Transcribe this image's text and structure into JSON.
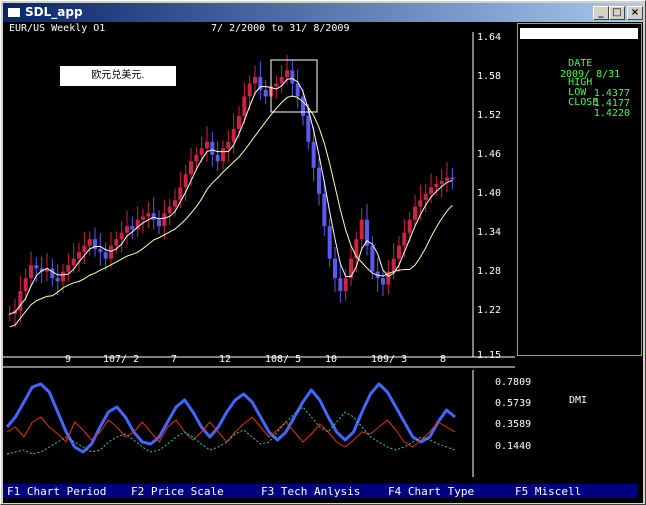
{
  "window": {
    "title": "SDL_app"
  },
  "chart_header": {
    "title": "EUR/US Weekly O1",
    "range": "7/ 2/2000 to 31/ 8/2009"
  },
  "chart_label": "欧元兑美元.",
  "info_panel": {
    "date_label": "DATE",
    "date_value": "2009/ 8/31",
    "high_label": "HIGH",
    "high_value": "1.4377",
    "low_label": "LOW",
    "low_value": "1.4177",
    "close_label": "CLOSE",
    "close_value": "1.4220"
  },
  "oscillator_label": "DMI",
  "function_keys": [
    "F1 Chart Period",
    "F2 Price Scale",
    "F3 Tech Anlysis",
    "F4 Chart Type",
    "F5 Miscell"
  ],
  "colors": {
    "bull": "#cc2244",
    "bear": "#5a5af0",
    "ma_fast": "#ffffff",
    "ma_slow": "#ffffaa",
    "adx": "#4466ff",
    "minus_di": "#dd3311",
    "plus_di": "#33ccaa",
    "panel_text": "#44ff44",
    "fkey_bar": "#000080"
  },
  "chart_data": [
    {
      "type": "candlestick",
      "title": "EUR/US Weekly O1",
      "subtitle": "7/ 2/2000 to 31/ 8/2009",
      "y_ticks": [
        "1.64",
        "1.58",
        "1.52",
        "1.46",
        "1.40",
        "1.34",
        "1.28",
        "1.22",
        "1.15"
      ],
      "ylim": [
        1.15,
        1.64
      ],
      "x_ticks": [
        "9",
        "107/ 2",
        "7",
        "12",
        "108/ 5",
        "10",
        "109/ 3",
        "8"
      ],
      "series": [
        {
          "name": "price",
          "values": [
            1.215,
            1.22,
            1.25,
            1.27,
            1.29,
            1.285,
            1.28,
            1.285,
            1.27,
            1.265,
            1.28,
            1.29,
            1.3,
            1.31,
            1.32,
            1.33,
            1.315,
            1.31,
            1.3,
            1.32,
            1.33,
            1.34,
            1.35,
            1.345,
            1.36,
            1.365,
            1.37,
            1.36,
            1.35,
            1.37,
            1.38,
            1.39,
            1.41,
            1.43,
            1.45,
            1.46,
            1.47,
            1.48,
            1.46,
            1.45,
            1.47,
            1.48,
            1.5,
            1.52,
            1.55,
            1.57,
            1.58,
            1.56,
            1.55,
            1.565,
            1.57,
            1.58,
            1.59,
            1.57,
            1.55,
            1.52,
            1.48,
            1.44,
            1.4,
            1.35,
            1.3,
            1.27,
            1.25,
            1.27,
            1.3,
            1.33,
            1.36,
            1.32,
            1.28,
            1.27,
            1.26,
            1.28,
            1.3,
            1.32,
            1.34,
            1.36,
            1.38,
            1.39,
            1.4,
            1.41,
            1.415,
            1.42,
            1.425,
            1.422
          ]
        }
      ]
    },
    {
      "type": "line",
      "y_ticks": [
        "0.7809",
        "0.5739",
        "0.3589",
        "0.1440"
      ],
      "ylim": [
        0.0,
        0.9
      ],
      "series": [
        {
          "name": "",
          "values": [
            0.35,
            0.45,
            0.6,
            0.75,
            0.78,
            0.7,
            0.5,
            0.3,
            0.15,
            0.1,
            0.18,
            0.35,
            0.5,
            0.55,
            0.45,
            0.3,
            0.2,
            0.18,
            0.25,
            0.4,
            0.55,
            0.62,
            0.5,
            0.35,
            0.25,
            0.35,
            0.5,
            0.62,
            0.68,
            0.6,
            0.45,
            0.3,
            0.22,
            0.3,
            0.45,
            0.6,
            0.72,
            0.62,
            0.45,
            0.3,
            0.22,
            0.3,
            0.5,
            0.68,
            0.78,
            0.7,
            0.55,
            0.4,
            0.25,
            0.2,
            0.25,
            0.4,
            0.52,
            0.45
          ]
        },
        {
          "name": "",
          "values": [
            0.3,
            0.35,
            0.25,
            0.4,
            0.45,
            0.35,
            0.28,
            0.2,
            0.4,
            0.32,
            0.22,
            0.3,
            0.42,
            0.35,
            0.25,
            0.3,
            0.4,
            0.3,
            0.2,
            0.35,
            0.42,
            0.3,
            0.22,
            0.3,
            0.4,
            0.3,
            0.2,
            0.3,
            0.38,
            0.45,
            0.35,
            0.25,
            0.32,
            0.4,
            0.3,
            0.2,
            0.28,
            0.38,
            0.3,
            0.2,
            0.15,
            0.22,
            0.3,
            0.28,
            0.35,
            0.42,
            0.32,
            0.2,
            0.15,
            0.22,
            0.3,
            0.4,
            0.35,
            0.3
          ]
        },
        {
          "name": "",
          "values": [
            0.08,
            0.1,
            0.12,
            0.08,
            0.1,
            0.15,
            0.2,
            0.25,
            0.2,
            0.15,
            0.1,
            0.12,
            0.2,
            0.25,
            0.28,
            0.22,
            0.15,
            0.1,
            0.12,
            0.18,
            0.25,
            0.3,
            0.25,
            0.18,
            0.12,
            0.15,
            0.2,
            0.28,
            0.32,
            0.25,
            0.18,
            0.2,
            0.3,
            0.4,
            0.48,
            0.55,
            0.45,
            0.35,
            0.3,
            0.4,
            0.5,
            0.45,
            0.35,
            0.25,
            0.2,
            0.15,
            0.12,
            0.15,
            0.2,
            0.25,
            0.22,
            0.18,
            0.15,
            0.12
          ]
        }
      ]
    }
  ]
}
